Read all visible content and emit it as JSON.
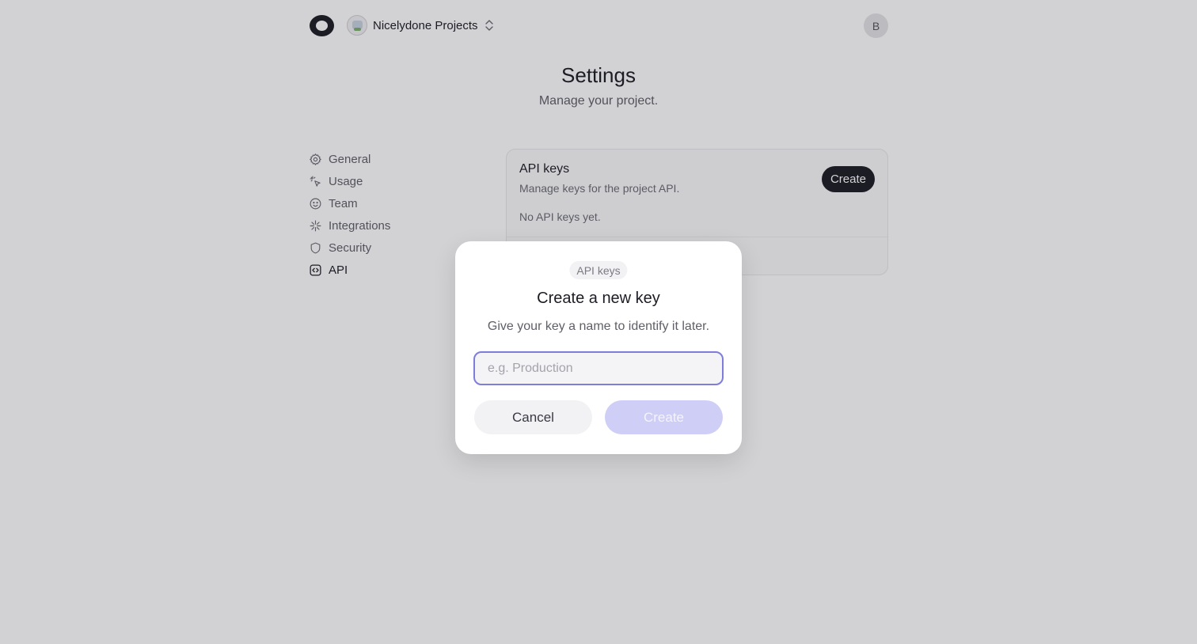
{
  "header": {
    "project_name": "Nicelydone Projects",
    "user_initial": "B"
  },
  "page": {
    "title": "Settings",
    "subtitle": "Manage your project."
  },
  "sidebar": {
    "items": [
      {
        "label": "General",
        "icon": "gear-icon"
      },
      {
        "label": "Usage",
        "icon": "cursor-click-icon"
      },
      {
        "label": "Team",
        "icon": "smiley-icon"
      },
      {
        "label": "Integrations",
        "icon": "sparkle-icon"
      },
      {
        "label": "Security",
        "icon": "shield-icon"
      },
      {
        "label": "API",
        "icon": "code-icon",
        "active": true
      }
    ]
  },
  "api_card": {
    "title": "API keys",
    "description": "Manage keys for the project API.",
    "empty_text": "No API keys yet.",
    "create_label": "Create"
  },
  "modal": {
    "badge": "API keys",
    "title": "Create a new key",
    "description": "Give your key a name to identify it later.",
    "input_value": "",
    "input_placeholder": "e.g. Production",
    "cancel_label": "Cancel",
    "create_label": "Create"
  },
  "colors": {
    "accent": "#7f7ddb",
    "accent_disabled": "#cfcef6",
    "dark": "#1c1c24"
  }
}
